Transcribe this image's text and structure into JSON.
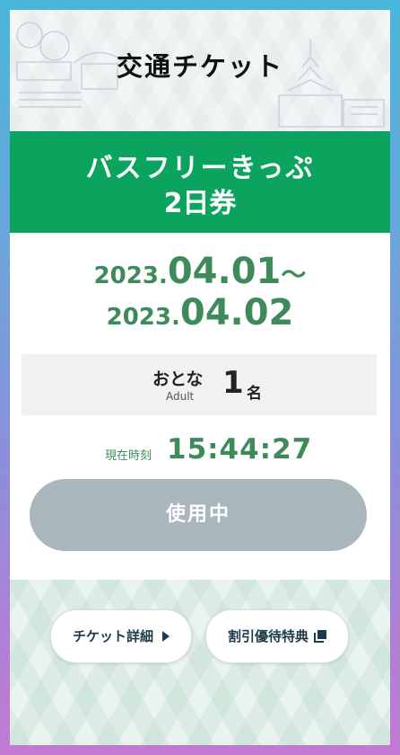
{
  "header": {
    "title": "交通チケット"
  },
  "ticket": {
    "name": "バスフリーきっぷ",
    "days": "2日券"
  },
  "validity": {
    "start_year": "2023.",
    "start_md": "04.01",
    "range_sep": "〜",
    "end_year": "2023.",
    "end_md": "04.02"
  },
  "passengers": {
    "label": "おとな",
    "sublabel": "Adult",
    "count": "1",
    "unit": "名"
  },
  "clock": {
    "label": "現在時刻",
    "time": "15:44:27"
  },
  "status": {
    "label": "使用中"
  },
  "footer": {
    "details_label": "チケット詳細",
    "discount_label": "割引優待特典"
  },
  "colors": {
    "accent_green": "#0ba45f",
    "text_green": "#3f8a5a",
    "status_gray": "#a9b6bb"
  },
  "icons": {
    "details": "triangle-right-icon",
    "discount": "external-link-icon"
  }
}
